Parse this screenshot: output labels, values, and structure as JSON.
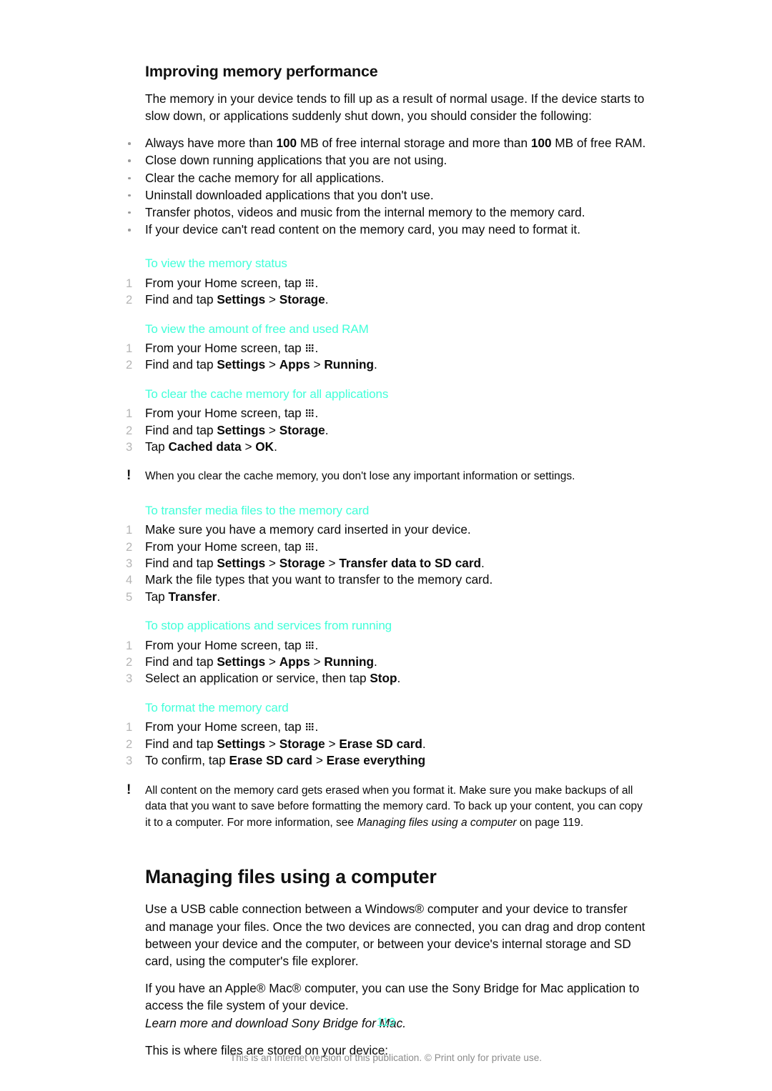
{
  "document": {
    "page_number": "119",
    "footer": "This is an Internet version of this publication. © Print only for private use.",
    "accent_color": "#41ffd9",
    "grid_icon_name": "app-drawer-grid-icon"
  },
  "section_memory": {
    "heading": "Improving memory performance",
    "intro": "The memory in your device tends to fill up as a result of normal usage. If the device starts to slow down, or applications suddenly shut down, you should consider the following:",
    "bullets": [
      {
        "pre": "Always have more than ",
        "bold1": "100",
        "mid": " MB of free internal storage and more than ",
        "bold2": "100",
        "post": " MB of free RAM."
      },
      {
        "text": "Close down running applications that you are not using."
      },
      {
        "text": "Clear the cache memory for all applications."
      },
      {
        "text": "Uninstall downloaded applications that you don't use."
      },
      {
        "text": "Transfer photos, videos and music from the internal memory to the memory card."
      },
      {
        "text": "If your device can't read content on the memory card, you may need to format it."
      }
    ]
  },
  "proc_memory_status": {
    "heading": "To view the memory status",
    "steps": [
      {
        "num": "1",
        "pre": "From your Home screen, tap ",
        "icon": true,
        "post": "."
      },
      {
        "num": "2",
        "pre": "Find and tap ",
        "bold1": "Settings",
        "sep1": " > ",
        "bold2": "Storage",
        "post": "."
      }
    ]
  },
  "proc_free_ram": {
    "heading": "To view the amount of free and used RAM",
    "steps": [
      {
        "num": "1",
        "pre": "From your Home screen, tap ",
        "icon": true,
        "post": "."
      },
      {
        "num": "2",
        "pre": "Find and tap ",
        "bold1": "Settings",
        "sep1": " > ",
        "bold2": "Apps",
        "sep2": " > ",
        "bold3": "Running",
        "post": "."
      }
    ]
  },
  "proc_clear_cache": {
    "heading": "To clear the cache memory for all applications",
    "steps": [
      {
        "num": "1",
        "pre": "From your Home screen, tap ",
        "icon": true,
        "post": "."
      },
      {
        "num": "2",
        "pre": "Find and tap ",
        "bold1": "Settings",
        "sep1": " > ",
        "bold2": "Storage",
        "post": "."
      },
      {
        "num": "3",
        "pre": "Tap ",
        "bold1": "Cached data",
        "sep1": " > ",
        "bold2": "OK",
        "post": "."
      }
    ],
    "note": "When you clear the cache memory, you don't lose any important information or settings."
  },
  "proc_transfer_media": {
    "heading": "To transfer media files to the memory card",
    "steps": [
      {
        "num": "1",
        "pre": "Make sure you have a memory card inserted in your device."
      },
      {
        "num": "2",
        "pre": "From your Home screen, tap ",
        "icon": true,
        "post": "."
      },
      {
        "num": "3",
        "pre": "Find and tap ",
        "bold1": "Settings",
        "sep1": " > ",
        "bold2": "Storage",
        "sep2": " > ",
        "bold3": "Transfer data to SD card",
        "post": "."
      },
      {
        "num": "4",
        "pre": "Mark the file types that you want to transfer to the memory card."
      },
      {
        "num": "5",
        "pre": "Tap ",
        "bold1": "Transfer",
        "post": "."
      }
    ]
  },
  "proc_stop_apps": {
    "heading": "To stop applications and services from running",
    "steps": [
      {
        "num": "1",
        "pre": "From your Home screen, tap ",
        "icon": true,
        "post": "."
      },
      {
        "num": "2",
        "pre": "Find and tap ",
        "bold1": "Settings",
        "sep1": " > ",
        "bold2": "Apps",
        "sep2": " > ",
        "bold3": "Running",
        "post": "."
      },
      {
        "num": "3",
        "pre": "Select an application or service, then tap ",
        "bold1": "Stop",
        "post": "."
      }
    ]
  },
  "proc_format_card": {
    "heading": "To format the memory card",
    "steps": [
      {
        "num": "1",
        "pre": "From your Home screen, tap ",
        "icon": true,
        "post": "."
      },
      {
        "num": "2",
        "pre": "Find and tap ",
        "bold1": "Settings",
        "sep1": " > ",
        "bold2": "Storage",
        "sep2": " > ",
        "bold3": "Erase SD card",
        "post": "."
      },
      {
        "num": "3",
        "pre": "To confirm, tap ",
        "bold1": "Erase SD card",
        "sep1": " > ",
        "bold2": "Erase everything",
        "post": ""
      }
    ],
    "note_part1": "All content on the memory card gets erased when you format it. Make sure you make backups of all data that you want to save before formatting the memory card. To back up your content, you can copy it to a computer. For more information, see ",
    "note_italic": "Managing files using a computer",
    "note_part2": " on page 119."
  },
  "section_managing_files": {
    "heading": "Managing files using a computer",
    "para1": "Use a USB cable connection between a Windows® computer and your device to transfer and manage your files. Once the two devices are connected, you can drag and drop content between your device and the computer, or between your device's internal storage and SD card, using the computer's file explorer.",
    "para2": "If you have an Apple® Mac® computer, you can use the Sony Bridge for Mac application to access the file system of your device.",
    "link_italic": "Learn more and download Sony Bridge for Mac.",
    "para3": "This is where files are stored on your device:"
  }
}
